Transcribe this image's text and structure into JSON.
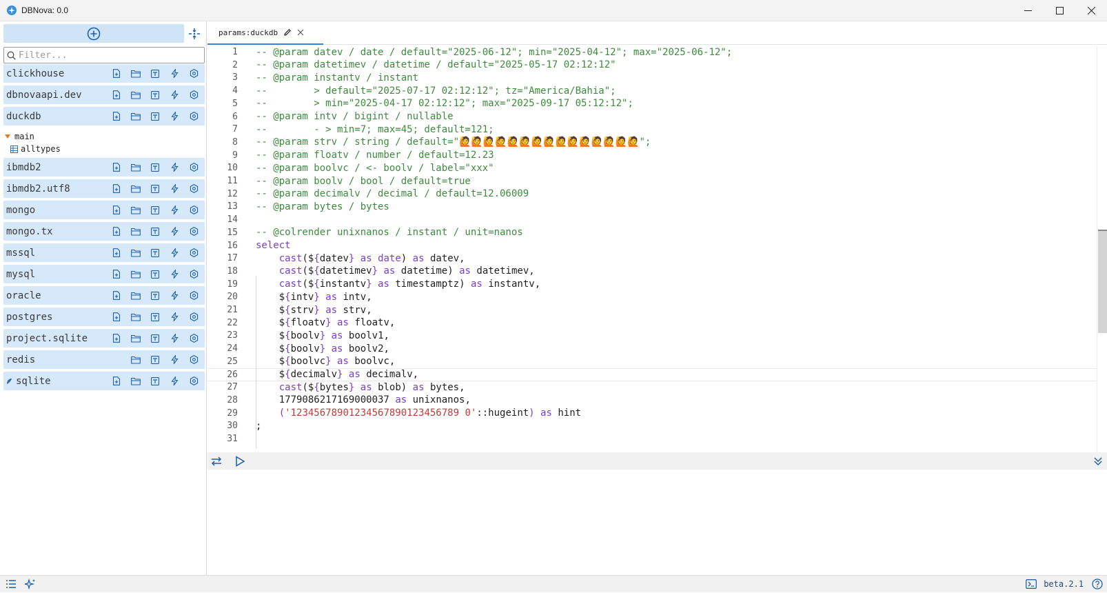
{
  "window": {
    "title": "DBNova: 0.0"
  },
  "sidebar": {
    "filter_placeholder": "Filter...",
    "connections": [
      {
        "name": "clickhouse"
      },
      {
        "name": "dbnovaapi.dev"
      },
      {
        "name": "duckdb"
      },
      {
        "name": "ibmdb2"
      },
      {
        "name": "ibmdb2.utf8"
      },
      {
        "name": "mongo"
      },
      {
        "name": "mongo.tx"
      },
      {
        "name": "mssql"
      },
      {
        "name": "mysql"
      },
      {
        "name": "oracle"
      },
      {
        "name": "postgres"
      },
      {
        "name": "project.sqlite"
      },
      {
        "name": "redis"
      },
      {
        "name": "sqlite"
      }
    ],
    "tree": {
      "schema": "main",
      "table": "alltypes"
    }
  },
  "tab": {
    "label": "params:duckdb"
  },
  "code": {
    "line_numbers": [
      "1",
      "2",
      "3",
      "4",
      "5",
      "6",
      "7",
      "8",
      "9",
      "10",
      "11",
      "12",
      "13",
      "14",
      "15",
      "16",
      "17",
      "18",
      "19",
      "20",
      "21",
      "22",
      "23",
      "24",
      "25",
      "26",
      "27",
      "28",
      "29",
      "30",
      "31"
    ],
    "l1": "-- @param datev / date / default=\"2025-06-12\"; min=\"2025-04-12\"; max=\"2025-06-12\";",
    "l2": "-- @param datetimev / datetime / default=\"2025-05-17 02:12:12\"",
    "l3": "-- @param instantv / instant",
    "l4": "--        > default=\"2025-07-17 02:12:12\"; tz=\"America/Bahia\";",
    "l5": "--        > min=\"2025-04-17 02:12:12\"; max=\"2025-09-17 05:12:12\";",
    "l6": "-- @param intv / bigint / nullable",
    "l7": "--        - > min=7; max=45; default=121;",
    "l8": "-- @param strv / string / default=\"🙋🙋🙋🙋🙋🙋🙋🙋🙋🙋🙋🙋🙋🙋🙋\";",
    "l9": "-- @param floatv / number / default=12.23",
    "l10": "-- @param boolvc / <- boolv / label=\"xxx\"",
    "l11": "-- @param boolv / bool / default=true",
    "l12": "-- @param decimalv / decimal / default=12.06009",
    "l13": "-- @param bytes / bytes",
    "l15": "-- @colrender unixnanos / instant / unit=nanos",
    "kw_select": "select",
    "cast": "cast",
    "as": "as",
    "dollar": "$",
    "open_brace": "{",
    "close_brace": "}",
    "open_paren": "(",
    "close_paren": ")",
    "comma": ",",
    "l17_var": "datev",
    "l17_type": "date",
    "l17_alias": "datev",
    "l18_var": "datetimev",
    "l18_type": "datetime",
    "l18_alias": "datetimev",
    "l19_var": "instantv",
    "l19_type": "timestamptz",
    "l19_alias": "instantv",
    "l20_var": "intv",
    "l20_alias": "intv",
    "l21_var": "strv",
    "l21_alias": "strv",
    "l22_var": "floatv",
    "l22_alias": "floatv",
    "l23_var": "boolv",
    "l23_alias": "boolv1",
    "l24_var": "boolv",
    "l24_alias": "boolv2",
    "l25_var": "boolvc",
    "l25_alias": "boolvc",
    "l26_var": "decimalv",
    "l26_alias": "decimalv",
    "l27_var": "bytes",
    "l27_type": "blob",
    "l27_alias": "bytes",
    "l28_num": "1779086217169000037",
    "l28_alias": "unixnanos",
    "l29_str": "'12345678901234567890123456789 0'",
    "l29_cast": "::hugeint",
    "l29_alias": "hint",
    "l30": ";"
  },
  "status": {
    "version": "beta.2.1"
  },
  "colors": {
    "accent": "#3b7ed6",
    "comment": "#3d8a3d",
    "keyword": "#7b3ec5",
    "string": "#c23b3b",
    "row_bg": "#d6e9fa"
  }
}
